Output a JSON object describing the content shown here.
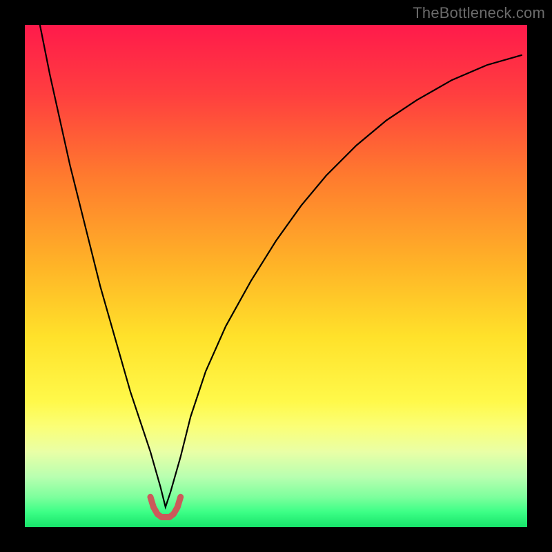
{
  "watermark": {
    "text": "TheBottleneck.com"
  },
  "gradient": {
    "stops": [
      {
        "pct": 0,
        "color": "#ff1a4b"
      },
      {
        "pct": 14,
        "color": "#ff3f3f"
      },
      {
        "pct": 30,
        "color": "#ff7a2e"
      },
      {
        "pct": 48,
        "color": "#ffb427"
      },
      {
        "pct": 62,
        "color": "#ffe12a"
      },
      {
        "pct": 75,
        "color": "#fff94a"
      },
      {
        "pct": 80,
        "color": "#fbff77"
      },
      {
        "pct": 85,
        "color": "#e9ffa6"
      },
      {
        "pct": 90,
        "color": "#b8ffb0"
      },
      {
        "pct": 94,
        "color": "#7dff9d"
      },
      {
        "pct": 97,
        "color": "#3cff86"
      },
      {
        "pct": 100,
        "color": "#17e36a"
      }
    ]
  },
  "chart_data": {
    "type": "line",
    "title": "",
    "xlabel": "",
    "ylabel": "",
    "xlim": [
      0,
      100
    ],
    "ylim": [
      0,
      100
    ],
    "notch": {
      "x": 28,
      "width": 6,
      "depth": 3
    },
    "series": [
      {
        "name": "curve",
        "stroke": "#000000",
        "stroke_width": 2.2,
        "x": [
          3,
          5,
          7,
          9,
          11,
          13,
          15,
          17,
          19,
          21,
          23,
          25,
          27,
          28,
          29,
          31,
          33,
          36,
          40,
          45,
          50,
          55,
          60,
          66,
          72,
          78,
          85,
          92,
          99
        ],
        "y": [
          100,
          90,
          81,
          72,
          64,
          56,
          48,
          41,
          34,
          27,
          21,
          15,
          8,
          4,
          7,
          14,
          22,
          31,
          40,
          49,
          57,
          64,
          70,
          76,
          81,
          85,
          89,
          92,
          94
        ]
      },
      {
        "name": "notch-marker",
        "stroke": "#cc5a5a",
        "stroke_width": 9,
        "linecap": "round",
        "x": [
          25.0,
          25.6,
          26.4,
          27.2,
          28.0,
          28.8,
          29.6,
          30.4,
          31.0
        ],
        "y": [
          6.0,
          4.0,
          2.6,
          2.0,
          2.0,
          2.0,
          2.6,
          4.0,
          6.0
        ]
      }
    ]
  }
}
